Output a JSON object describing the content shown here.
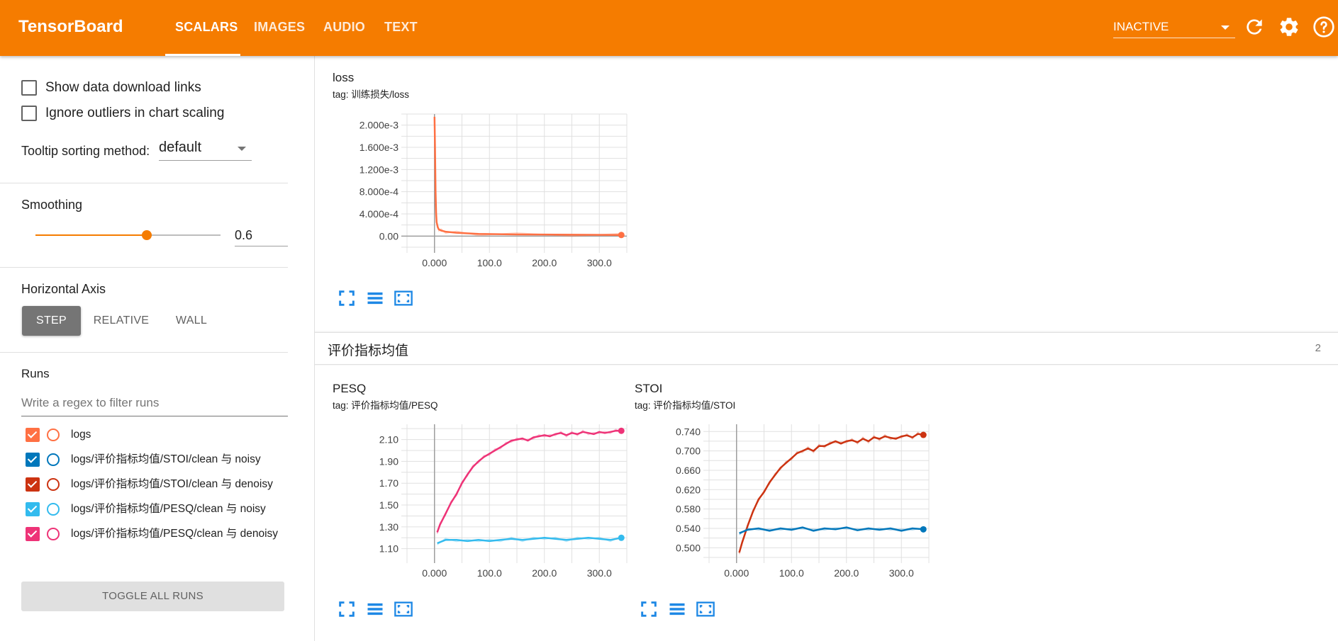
{
  "header": {
    "brand": "TensorBoard",
    "tabs": [
      {
        "label": "SCALARS",
        "active": true
      },
      {
        "label": "IMAGES",
        "active": false
      },
      {
        "label": "AUDIO",
        "active": false
      },
      {
        "label": "TEXT",
        "active": false
      }
    ],
    "run_state": "INACTIVE",
    "icons": [
      "refresh-icon",
      "settings-icon",
      "help-icon"
    ]
  },
  "sidebar": {
    "show_download_links": "Show data download links",
    "ignore_outliers": "Ignore outliers in chart scaling",
    "tooltip_label": "Tooltip sorting method:",
    "tooltip_value": "default",
    "smoothing_label": "Smoothing",
    "smoothing_value": "0.6",
    "smoothing_fraction": 0.6,
    "horizontal_axis_label": "Horizontal Axis",
    "axis_buttons": [
      "STEP",
      "RELATIVE",
      "WALL"
    ],
    "axis_selected": "STEP",
    "runs_label": "Runs",
    "filter_placeholder": "Write a regex to filter runs",
    "runs": [
      {
        "label": "logs",
        "color": "#ff7043"
      },
      {
        "label": "logs/评价指标均值/STOI/clean 与 noisy",
        "color": "#0077bb"
      },
      {
        "label": "logs/评价指标均值/STOI/clean 与 denoisy",
        "color": "#cc3311"
      },
      {
        "label": "logs/评价指标均值/PESQ/clean 与 noisy",
        "color": "#33bbee"
      },
      {
        "label": "logs/评价指标均值/PESQ/clean 与 denoisy",
        "color": "#ee3377"
      }
    ],
    "toggle_all": "TOGGLE ALL RUNS"
  },
  "main": {
    "group_name": "评价指标均值",
    "group_count": "2"
  },
  "chart_data": [
    {
      "type": "line",
      "title": "loss",
      "tag": "tag: 训练损失/loss",
      "xlim": [
        -50,
        350
      ],
      "ylim": [
        -0.0002,
        0.0022
      ],
      "x_ticks": [
        "0.000",
        "100.0",
        "200.0",
        "300.0"
      ],
      "y_ticks": [
        "0.00",
        "4.000e-4",
        "8.000e-4",
        "1.200e-3",
        "1.600e-3",
        "2.000e-3"
      ],
      "series": [
        {
          "name": "logs",
          "color": "#ff7043",
          "x": [
            0,
            1,
            2,
            3,
            4,
            6,
            8,
            12,
            20,
            40,
            80,
            150,
            250,
            340
          ],
          "y": [
            0.00215,
            0.0016,
            0.0008,
            0.0004,
            0.00025,
            0.00016,
            0.00012,
            0.0001,
            8e-05,
            6e-05,
            4e-05,
            3e-05,
            2.5e-05,
            2e-05
          ]
        }
      ]
    },
    {
      "type": "line",
      "title": "PESQ",
      "tag": "tag: 评价指标均值/PESQ",
      "xlim": [
        -50,
        350
      ],
      "ylim": [
        1.02,
        2.24
      ],
      "x_ticks": [
        "0.000",
        "100.0",
        "200.0",
        "300.0"
      ],
      "y_ticks": [
        "1.10",
        "1.30",
        "1.50",
        "1.70",
        "1.90",
        "2.10"
      ],
      "series": [
        {
          "name": "logs/评价指标均值/PESQ/clean 与 denoisy",
          "color": "#ee3377",
          "x": [
            5,
            10,
            20,
            30,
            40,
            50,
            60,
            70,
            80,
            90,
            100,
            110,
            120,
            130,
            140,
            150,
            160,
            170,
            180,
            190,
            200,
            210,
            220,
            230,
            240,
            250,
            260,
            270,
            280,
            290,
            300,
            310,
            320,
            330,
            340
          ],
          "y": [
            1.25,
            1.32,
            1.42,
            1.52,
            1.6,
            1.7,
            1.78,
            1.85,
            1.9,
            1.94,
            1.97,
            2.0,
            2.03,
            2.06,
            2.09,
            2.1,
            2.11,
            2.09,
            2.12,
            2.13,
            2.14,
            2.13,
            2.15,
            2.16,
            2.14,
            2.16,
            2.15,
            2.17,
            2.16,
            2.15,
            2.17,
            2.16,
            2.17,
            2.18,
            2.18
          ]
        },
        {
          "name": "logs/评价指标均值/PESQ/clean 与 noisy",
          "color": "#33bbee",
          "x": [
            5,
            20,
            40,
            60,
            80,
            100,
            120,
            140,
            160,
            180,
            200,
            220,
            240,
            260,
            280,
            300,
            320,
            340
          ],
          "y": [
            1.15,
            1.18,
            1.18,
            1.17,
            1.18,
            1.17,
            1.18,
            1.19,
            1.18,
            1.19,
            1.2,
            1.19,
            1.18,
            1.19,
            1.2,
            1.19,
            1.18,
            1.2
          ]
        }
      ]
    },
    {
      "type": "line",
      "title": "STOI",
      "tag": "tag: 评价指标均值/STOI",
      "xlim": [
        -50,
        350
      ],
      "ylim": [
        0.48,
        0.755
      ],
      "x_ticks": [
        "0.000",
        "100.0",
        "200.0",
        "300.0"
      ],
      "y_ticks": [
        "0.500",
        "0.540",
        "0.580",
        "0.620",
        "0.660",
        "0.700",
        "0.740"
      ],
      "series": [
        {
          "name": "logs/评价指标均值/STOI/clean 与 denoisy",
          "color": "#cc3311",
          "x": [
            5,
            10,
            20,
            30,
            40,
            50,
            60,
            70,
            80,
            90,
            100,
            110,
            120,
            130,
            140,
            150,
            160,
            170,
            180,
            190,
            200,
            210,
            220,
            230,
            240,
            250,
            260,
            270,
            280,
            290,
            300,
            310,
            320,
            330,
            340
          ],
          "y": [
            0.49,
            0.51,
            0.545,
            0.575,
            0.6,
            0.615,
            0.635,
            0.65,
            0.665,
            0.675,
            0.685,
            0.695,
            0.7,
            0.705,
            0.7,
            0.71,
            0.71,
            0.715,
            0.72,
            0.715,
            0.72,
            0.722,
            0.718,
            0.725,
            0.72,
            0.728,
            0.725,
            0.73,
            0.727,
            0.725,
            0.73,
            0.732,
            0.728,
            0.735,
            0.733
          ]
        },
        {
          "name": "logs/评价指标均值/STOI/clean 与 noisy",
          "color": "#0077bb",
          "x": [
            5,
            20,
            40,
            60,
            80,
            100,
            120,
            140,
            160,
            180,
            200,
            220,
            240,
            260,
            280,
            300,
            320,
            340
          ],
          "y": [
            0.53,
            0.537,
            0.54,
            0.535,
            0.54,
            0.537,
            0.542,
            0.535,
            0.54,
            0.538,
            0.542,
            0.536,
            0.54,
            0.537,
            0.54,
            0.535,
            0.54,
            0.538
          ]
        }
      ]
    }
  ]
}
